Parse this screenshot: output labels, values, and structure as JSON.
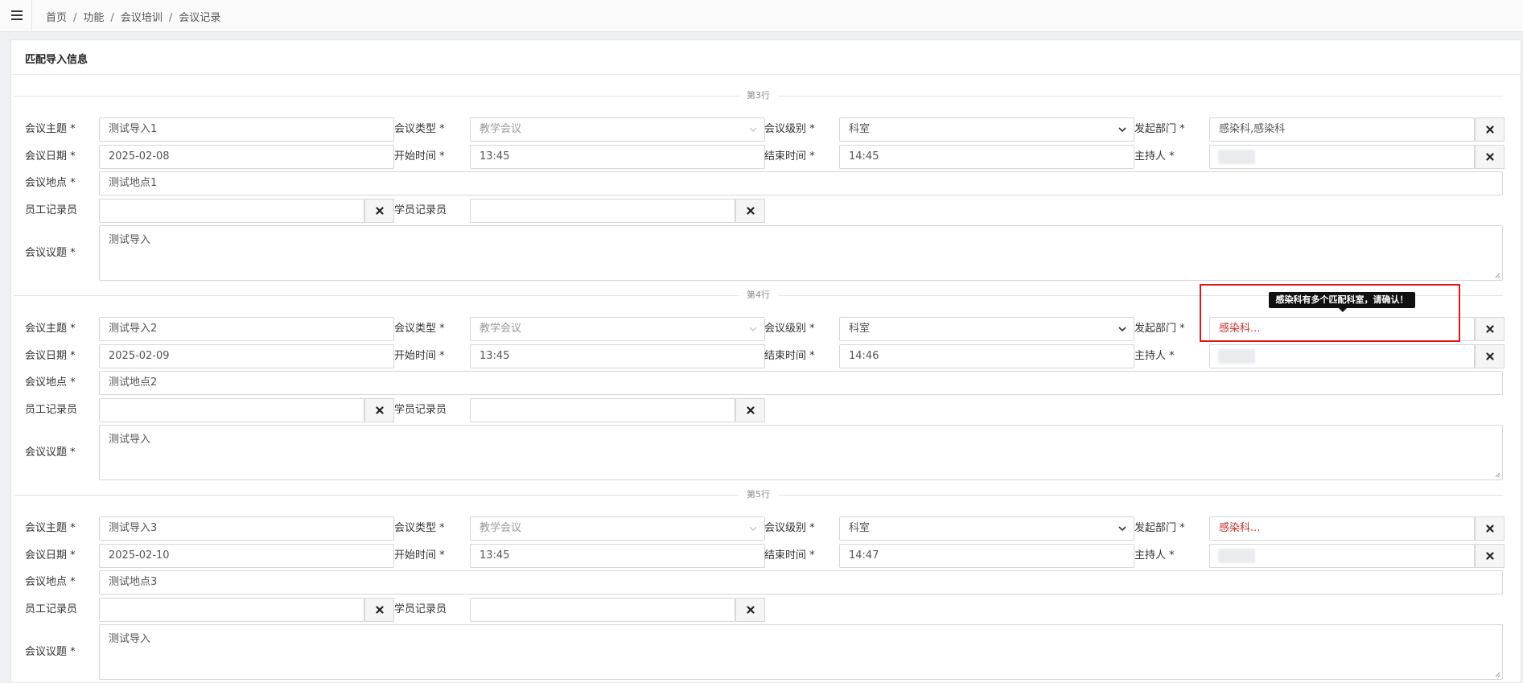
{
  "breadcrumb": {
    "items": [
      "首页",
      "功能",
      "会议培训",
      "会议记录"
    ],
    "separator": "/"
  },
  "panel": {
    "title": "匹配导入信息"
  },
  "labels": {
    "subject": "会议主题 *",
    "type": "会议类型 *",
    "level": "会议级别 *",
    "dept": "发起部门 *",
    "date": "会议日期 *",
    "start": "开始时间 *",
    "end": "结束时间 *",
    "host": "主持人 *",
    "location": "会议地点 *",
    "staff_recorder": "员工记录员",
    "student_recorder": "学员记录员",
    "agenda": "会议议题 *"
  },
  "records": [
    {
      "row_label": "第3行",
      "subject": "测试导入1",
      "type": "教学会议",
      "level": "科室",
      "dept": "感染科,感染科",
      "date": "2025-02-08",
      "start": "13:45",
      "end": "14:45",
      "host": "",
      "location": "测试地点1",
      "staff_recorder": "",
      "student_recorder": "",
      "agenda": "测试导入"
    },
    {
      "row_label": "第4行",
      "subject": "测试导入2",
      "type": "教学会议",
      "level": "科室",
      "dept": "感染科...",
      "date": "2025-02-09",
      "start": "13:45",
      "end": "14:46",
      "host": "",
      "location": "测试地点2",
      "staff_recorder": "",
      "student_recorder": "",
      "agenda": "测试导入"
    },
    {
      "row_label": "第5行",
      "subject": "测试导入3",
      "type": "教学会议",
      "level": "科室",
      "dept": "感染科...",
      "date": "2025-02-10",
      "start": "13:45",
      "end": "14:47",
      "host": "",
      "location": "测试地点3",
      "staff_recorder": "",
      "student_recorder": "",
      "agenda": "测试导入"
    }
  ],
  "tooltip": {
    "text": "感染科有多个匹配科室，请确认！"
  },
  "colors": {
    "warning_text": "#c9302c",
    "highlight_border": "#e0191f",
    "tooltip_bg": "#111111"
  }
}
